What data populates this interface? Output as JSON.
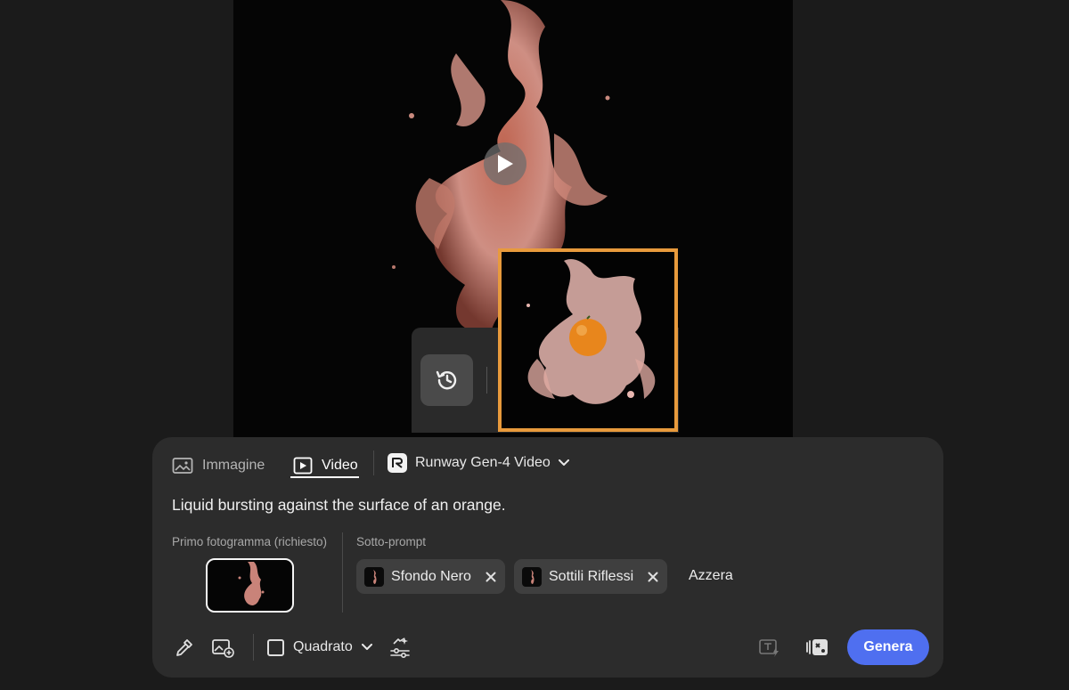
{
  "preview": {
    "play_icon": "play-icon"
  },
  "history": {
    "icon": "history-icon"
  },
  "tabs": [
    {
      "label": "Immagine",
      "icon": "image-icon"
    },
    {
      "label": "Video",
      "icon": "video-icon"
    }
  ],
  "model": {
    "label": "Runway Gen-4 Video",
    "icon": "runway-logo-icon"
  },
  "prompt": "Liquid bursting against the surface of an orange.",
  "first_frame": {
    "label": "Primo fotogramma (richiesto)"
  },
  "subprompts": {
    "label": "Sotto-prompt",
    "chips": [
      {
        "label": "Sfondo Nero"
      },
      {
        "label": "Sottili Riflessi"
      }
    ],
    "reset_label": "Azzera"
  },
  "toolbar": {
    "aspect_label": "Quadrato",
    "generate_label": "Genera"
  },
  "colors": {
    "accent": "#4f6ff0",
    "selection": "#e89a3c",
    "panel": "#2c2c2c",
    "background": "#1b1b1b"
  }
}
